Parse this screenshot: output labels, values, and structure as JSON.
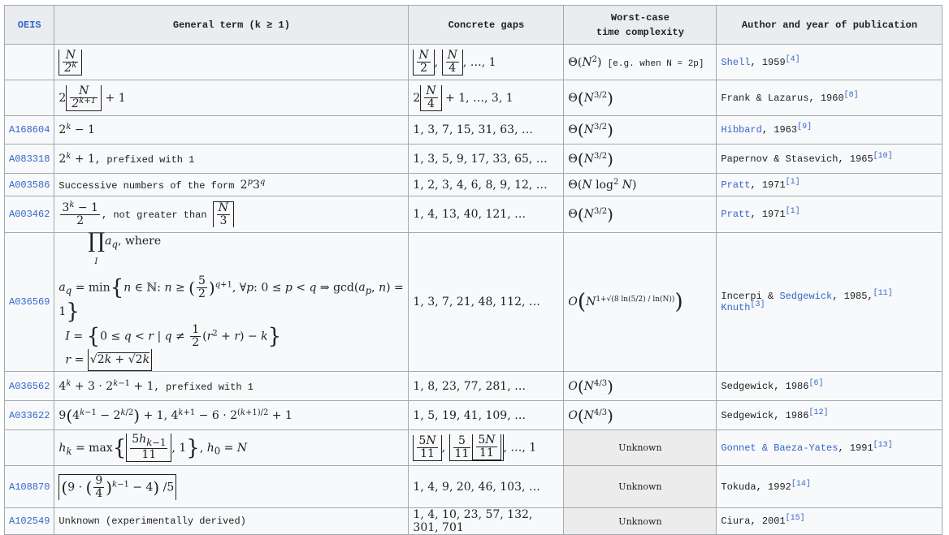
{
  "headers": {
    "oeis": "OEIS",
    "general_term": "General term (k ≥ 1)",
    "gaps": "Concrete gaps",
    "complexity_l1": "Worst-case",
    "complexity_l2": "time complexity",
    "author": "Author and year of publication"
  },
  "rows": [
    {
      "oeis": "",
      "author": "Shell",
      "author_is_link": true,
      "year": ", 1959",
      "ref": "[4]",
      "complexity_note": "[e.g. when N = 2p]"
    },
    {
      "oeis": "",
      "author": "Frank & Lazarus",
      "author_is_link": false,
      "year": ", 1960",
      "ref": "[8]"
    },
    {
      "oeis": "A168604",
      "author": "Hibbard",
      "author_is_link": true,
      "year": ", 1963",
      "ref": "[9]",
      "gaps": "1, 3, 7, 15, 31, 63, …"
    },
    {
      "oeis": "A083318",
      "author": "Papernov & Stasevich",
      "author_is_link": false,
      "year": ", 1965",
      "ref": "[10]",
      "gaps": "1, 3, 5, 9, 17, 33, 65, …",
      "term_suffix": ", prefixed with 1"
    },
    {
      "oeis": "A003586",
      "author": "Pratt",
      "author_is_link": true,
      "year": ", 1971",
      "ref": "[1]",
      "gaps": "1, 2, 3, 4, 6, 8, 9, 12, …",
      "term_text": "Successive numbers of the form "
    },
    {
      "oeis": "A003462",
      "author": "Pratt",
      "author_is_link": true,
      "year": ", 1971",
      "ref": "[1]",
      "gaps": "1, 4, 13, 40, 121, …",
      "term_text": ", not greater than"
    },
    {
      "oeis": "A036569",
      "author": "Incerpi & ",
      "author2": "Sedgewick",
      "year": ", 1985,",
      "ref": "[11]",
      "author3": "Knuth",
      "ref2": "[3]",
      "gaps": "1, 3, 7, 21, 48, 112, …"
    },
    {
      "oeis": "A036562",
      "author": "Sedgewick",
      "author_is_link": false,
      "year": ", 1986",
      "ref": "[6]",
      "gaps": "1, 8, 23, 77, 281, …",
      "term_suffix": ", prefixed with 1"
    },
    {
      "oeis": "A033622",
      "author": "Sedgewick",
      "author_is_link": false,
      "year": ", 1986",
      "ref": "[12]",
      "gaps": "1, 5, 19, 41, 109, …"
    },
    {
      "oeis": "",
      "author": "Gonnet & Baeza-Yates",
      "author_is_link": true,
      "year": ", 1991",
      "ref": "[13]",
      "complexity": "Unknown"
    },
    {
      "oeis": "A108870",
      "author": "Tokuda",
      "author_is_link": false,
      "year": ", 1992",
      "ref": "[14]",
      "gaps": "1, 4, 9, 20, 46, 103, …",
      "complexity": "Unknown"
    },
    {
      "oeis": "A102549",
      "author": "Ciura",
      "author_is_link": false,
      "year": ", 2001",
      "ref": "[15]",
      "gaps": "1, 4, 10, 23, 57, 132, 301, 701",
      "complexity": "Unknown",
      "term_text": "Unknown (experimentally derived)"
    }
  ]
}
